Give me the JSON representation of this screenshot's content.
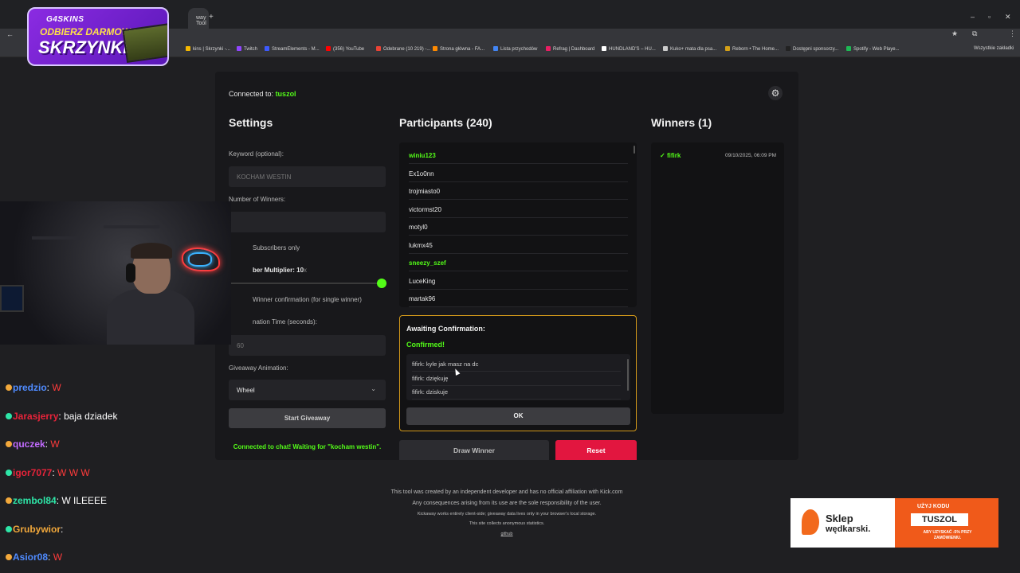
{
  "browser": {
    "active_tab_title": "way Tool",
    "new_tab": "+",
    "bookmarks": [
      {
        "label": "kins | Skrzynki -...",
        "color": "#f5b800"
      },
      {
        "label": "Twitch",
        "color": "#9146ff"
      },
      {
        "label": "StreamElements - M...",
        "color": "#3d5afe"
      },
      {
        "label": "(356) YouTube",
        "color": "#ff0000"
      },
      {
        "label": "Odebrane (10 219) -...",
        "color": "#ea4335"
      },
      {
        "label": "Strona główna - FA...",
        "color": "#ff8a00"
      },
      {
        "label": "Lista przychodów",
        "color": "#4285f4"
      },
      {
        "label": "Refrag | Dashboard",
        "color": "#e91e63"
      },
      {
        "label": "HUNDLAND'S – HU...",
        "color": "#ffffff"
      },
      {
        "label": "Kuko+ mata dla psa...",
        "color": "#cccccc"
      },
      {
        "label": "Reborn • The Home...",
        "color": "#d4a017"
      },
      {
        "label": "Dostępni sponsorzy...",
        "color": "#222222"
      },
      {
        "label": "Spotify - Web Playe...",
        "color": "#1db954"
      }
    ],
    "all_bookmarks": "Wszystkie zakładki"
  },
  "promo": {
    "logo": "G4SKINS",
    "line1": "ODBIERZ DARMOWĄ",
    "line2": "SKRZYNKĘ!"
  },
  "app": {
    "connected_label": "Connected to:",
    "channel": "tuszol",
    "settings": {
      "title": "Settings",
      "keyword_label": "Keyword (optional):",
      "keyword_value": "KOCHAM WESTIN",
      "winners_label": "Number of Winners:",
      "subs_only_label": "Subscribers only",
      "multiplier_label": "ber Multiplier: 10",
      "multiplier_suffix": "x",
      "winner_confirm_label": "Winner confirmation (for single winner)",
      "time_label": "nation Time (seconds):",
      "time_value": "60",
      "animation_label": "Giveaway Animation:",
      "animation_value": "Wheel",
      "start_button": "Start Giveaway",
      "status": "Connected to chat! Waiting for \"kocham westin\"."
    },
    "participants": {
      "title": "Participants (240)",
      "items": [
        {
          "name": "winiu123",
          "subscriber": true
        },
        {
          "name": "Ex1o0nn",
          "subscriber": false
        },
        {
          "name": "trojmiasto0",
          "subscriber": false
        },
        {
          "name": "victormst20",
          "subscriber": false
        },
        {
          "name": "motyl0",
          "subscriber": false
        },
        {
          "name": "lukmx45",
          "subscriber": false
        },
        {
          "name": "sneezy_szef",
          "subscriber": true
        },
        {
          "name": "LuceKing",
          "subscriber": false
        },
        {
          "name": "martak96",
          "subscriber": false
        }
      ]
    },
    "awaiting": {
      "title": "Awaiting Confirmation:",
      "confirmed": "Confirmed!",
      "messages": [
        "fifirk: kyle jak masz na dc",
        "fifirk: dziękuję",
        "fifirk: dziskuje"
      ],
      "ok_button": "OK"
    },
    "draw_button": "Draw Winner",
    "reset_button": "Reset",
    "winners": {
      "title": "Winners (1)",
      "items": [
        {
          "check": "✓",
          "name": "fifirk",
          "date": "09/10/2025, 06:09 PM"
        }
      ]
    }
  },
  "footer": {
    "line1": "This tool was created by an independent developer and has no official affiliation with Kick.com",
    "line2": "Any consequences arising from its use are the sole responsibility of the user.",
    "line3": "Kickaway works entirely client-side; giveaway data lives only in your browser's local storage.",
    "line4": "This site collects anonymous statistics.",
    "link": "github"
  },
  "chat": [
    {
      "user": "predzio",
      "color": "#4f8bff",
      "msg": "W",
      "msg_color": "#ff3b3b"
    },
    {
      "user": "Jarasjerry",
      "color": "#e8233a",
      "msg": "baja dziadek",
      "msg_color": "#ffffff"
    },
    {
      "user": "quczek",
      "color": "#c26bff",
      "msg": "W",
      "msg_color": "#ff3b3b"
    },
    {
      "user": "igor7077",
      "color": "#e8233a",
      "msg": "W W W",
      "msg_color": "#ff3b3b"
    },
    {
      "user": "zembol84",
      "color": "#2ee6a8",
      "msg": "W ILEEEE",
      "msg_color": "#ffffff"
    },
    {
      "user": "Grubywior",
      "color": "#f2a83b",
      "msg": "",
      "msg_color": "#ffffff"
    },
    {
      "user": "Asior08",
      "color": "#4f8bff",
      "msg": "W",
      "msg_color": "#ff3b3b"
    }
  ],
  "ad": {
    "brand1": "Sklep",
    "brand2": "wędkarski.",
    "use_code": "UŻYJ KODU",
    "code": "TUSZOL",
    "fine": "ABY UZYSKAĆ -5% PRZY ZAMÓWIENIU."
  },
  "colors": {
    "kick_green": "#53fc18",
    "reset_red": "#e2163f",
    "await_border": "#d49a1a"
  }
}
